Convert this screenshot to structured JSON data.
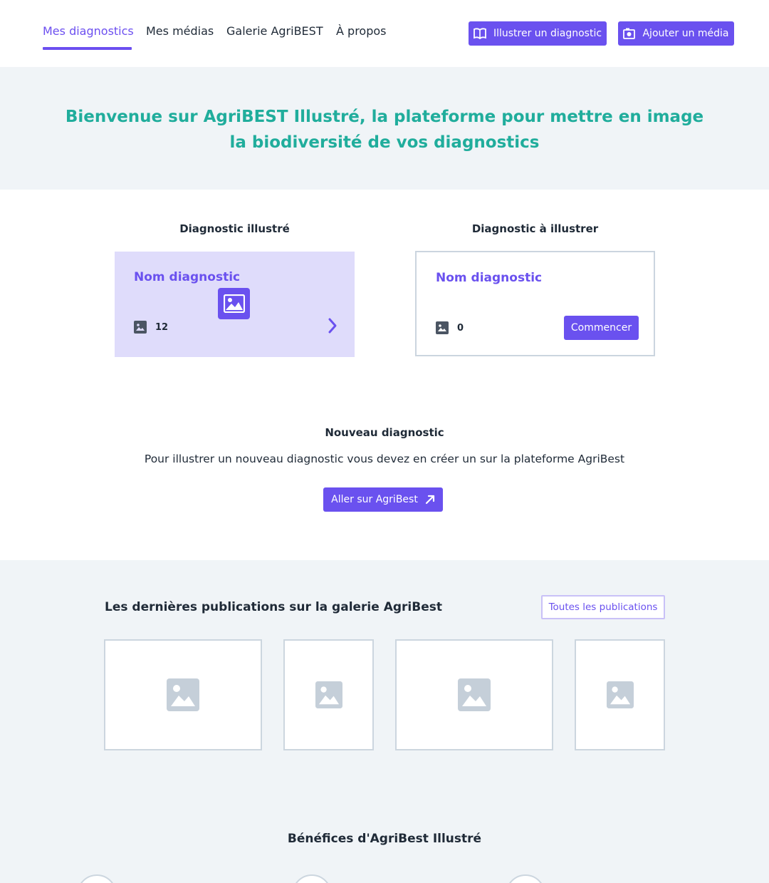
{
  "nav": {
    "tabs": [
      {
        "label": "Mes diagnostics",
        "active": true
      },
      {
        "label": "Mes médias",
        "active": false
      },
      {
        "label": "Galerie AgriBEST",
        "active": false
      },
      {
        "label": "À propos",
        "active": false
      }
    ],
    "illustrate_button": "Illustrer un diagnostic",
    "add_media_button": "Ajouter un média"
  },
  "hero": {
    "title_line1": "Bienvenue sur AgriBEST Illustré, la plateforme pour mettre en image",
    "title_line2": "la biodiversité de vos diagnostics"
  },
  "diagnostics": {
    "illustrated": {
      "heading": "Diagnostic illustré",
      "name": "Nom diagnostic",
      "media_count": "12"
    },
    "todo": {
      "heading": "Diagnostic à illustrer",
      "name": "Nom diagnostic",
      "media_count": "0",
      "start_button": "Commencer"
    }
  },
  "new_diagnostic": {
    "heading": "Nouveau diagnostic",
    "description": "Pour illustrer un nouveau diagnostic vous devez en créer un sur la plateforme AgriBest",
    "button": "Aller sur AgriBest"
  },
  "gallery": {
    "title": "Les dernières publications sur la galerie AgriBest",
    "all_button": "Toutes les publications"
  },
  "benefits": {
    "title": "Bénéfices d'AgriBest Illustré"
  },
  "colors": {
    "accent": "#6a51ef",
    "hero_text": "#20ad9c",
    "hero_bg": "#f0f4f7",
    "card_illustrated_bg": "#dfdcfb"
  }
}
